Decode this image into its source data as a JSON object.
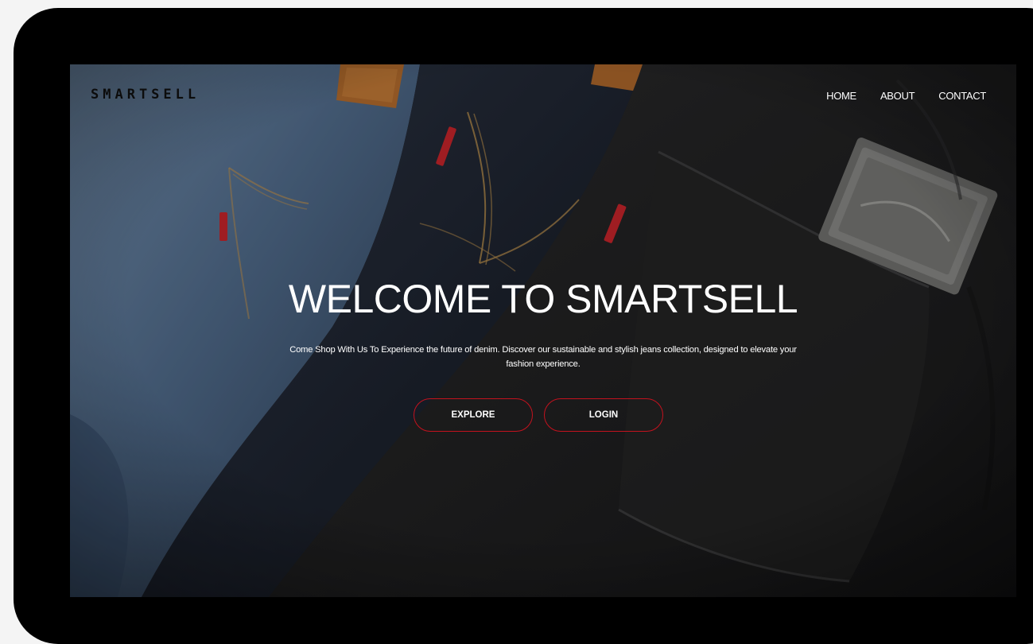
{
  "header": {
    "logo_text": "SMARTSELL",
    "nav": [
      {
        "label": "HOME"
      },
      {
        "label": "ABOUT"
      },
      {
        "label": "CONTACT"
      }
    ]
  },
  "hero": {
    "title": "WELCOME TO SMARTSELL",
    "description": "Come Shop With Us To Experience the future of denim. Discover our sustainable and stylish jeans collection, designed to elevate your fashion experience.",
    "buttons": {
      "explore": "EXPLORE",
      "login": "LOGIN"
    }
  },
  "colors": {
    "accent_border": "#c4121e",
    "device_frame": "#000000",
    "page_background": "#f4f4f4",
    "text": "#ffffff"
  },
  "icons": {
    "background_image": "denim-jeans-photo"
  }
}
